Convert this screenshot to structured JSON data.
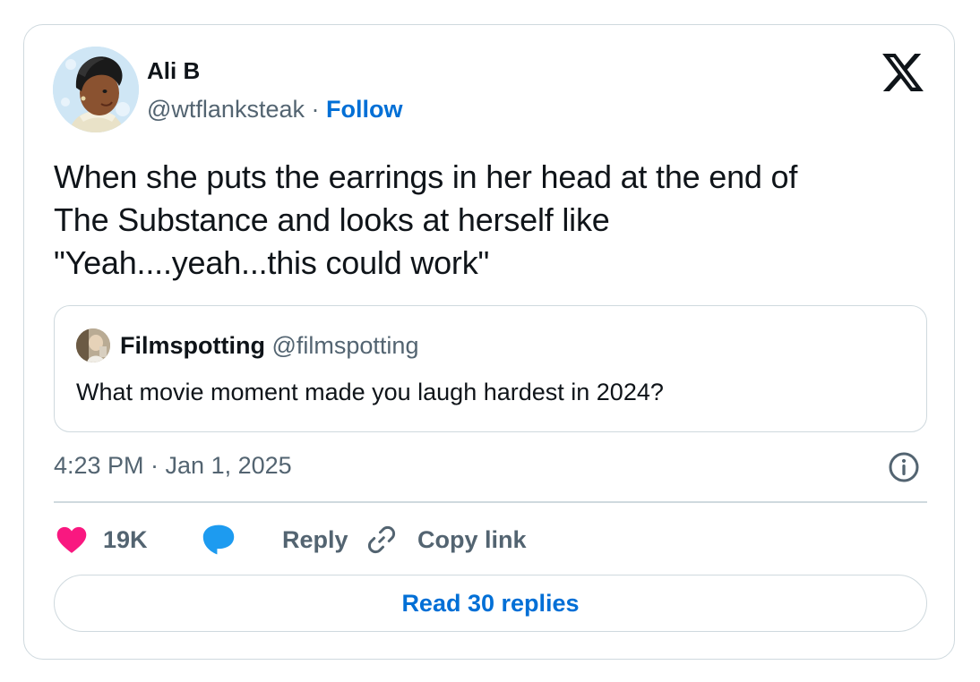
{
  "author": {
    "display_name": "Ali B",
    "handle": "@wtflanksteak",
    "separator": "·",
    "follow_label": "Follow"
  },
  "tweet": {
    "text": "When she puts the earrings in her head at the end of\nThe Substance and looks at herself like\n\"Yeah....yeah...this could work\"",
    "timestamp": "4:23 PM · Jan 1, 2025"
  },
  "quoted_tweet": {
    "display_name": "Filmspotting",
    "handle": "@filmspotting",
    "text": "What movie moment made you laugh hardest in 2024?"
  },
  "actions": {
    "like_count": "19K",
    "reply_label": "Reply",
    "copy_link_label": "Copy link"
  },
  "read_replies_label": "Read 30 replies",
  "icons": {
    "brand": "x-logo-icon",
    "info": "info-icon",
    "like": "heart-icon",
    "reply": "speech-bubble-icon",
    "copy": "link-icon"
  },
  "colors": {
    "link_blue": "#006fd6",
    "heart_pink": "#f91880",
    "reply_blue": "#1d9bf0",
    "secondary_text": "#536471",
    "border": "#cfd9de"
  }
}
